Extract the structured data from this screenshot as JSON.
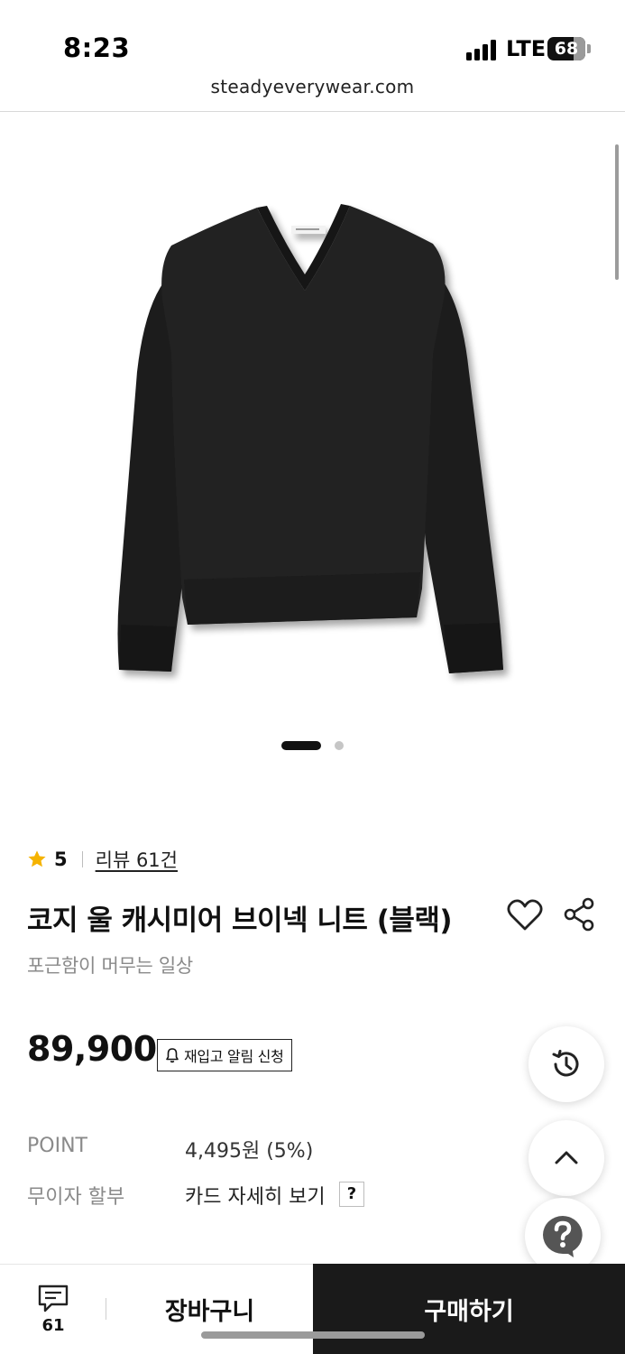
{
  "status_bar": {
    "time": "8:23",
    "network": "LTE",
    "battery": "68",
    "battery_level_percent": 68
  },
  "browser": {
    "url": "steadyeverywear.com"
  },
  "gallery": {
    "image_subject": "black-v-neck-sweater",
    "slide_count": 2,
    "active_slide": 1
  },
  "product": {
    "rating": "5",
    "review_link": "리뷰 61건",
    "title": "코지 울 캐시미어 브이넥 니트 (블랙)",
    "subtitle": "포근함이 머무는 일상",
    "price": "89,900",
    "restock_button": "재입고 알림 신청"
  },
  "details": {
    "point_label": "POINT",
    "point_value": "4,495원 (5%)",
    "installment_label": "무이자 할부",
    "installment_value": "카드 자세히 보기",
    "help_mark": "?"
  },
  "bottom_bar": {
    "comment_count": "61",
    "cart_label": "장바구니",
    "buy_label": "구매하기"
  },
  "colors": {
    "accent_star": "#f5b300",
    "buy_button_bg": "#1a1a1a",
    "muted_text": "#8a8a8a"
  },
  "icons": [
    "star-icon",
    "heart-icon",
    "share-icon",
    "bell-icon",
    "history-icon",
    "chevron-up-icon",
    "help-icon",
    "comment-icon"
  ]
}
